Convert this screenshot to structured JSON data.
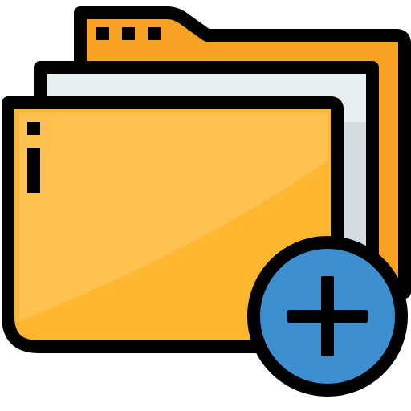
{
  "icon": {
    "name": "add-folder-icon",
    "depicts": [
      "folder-icon",
      "paper-sheet-icon",
      "plus-icon"
    ]
  },
  "colors": {
    "outline": "#000000",
    "folder_back": "#F7A223",
    "folder_front": "#FFB630",
    "folder_front_highlight": "#FFC250",
    "paper": "#E8EEF0",
    "paper_shadow": "#D5DCDF",
    "plus_circle": "#3D8FCF",
    "plus_circle_highlight": "#4A9FE0"
  }
}
